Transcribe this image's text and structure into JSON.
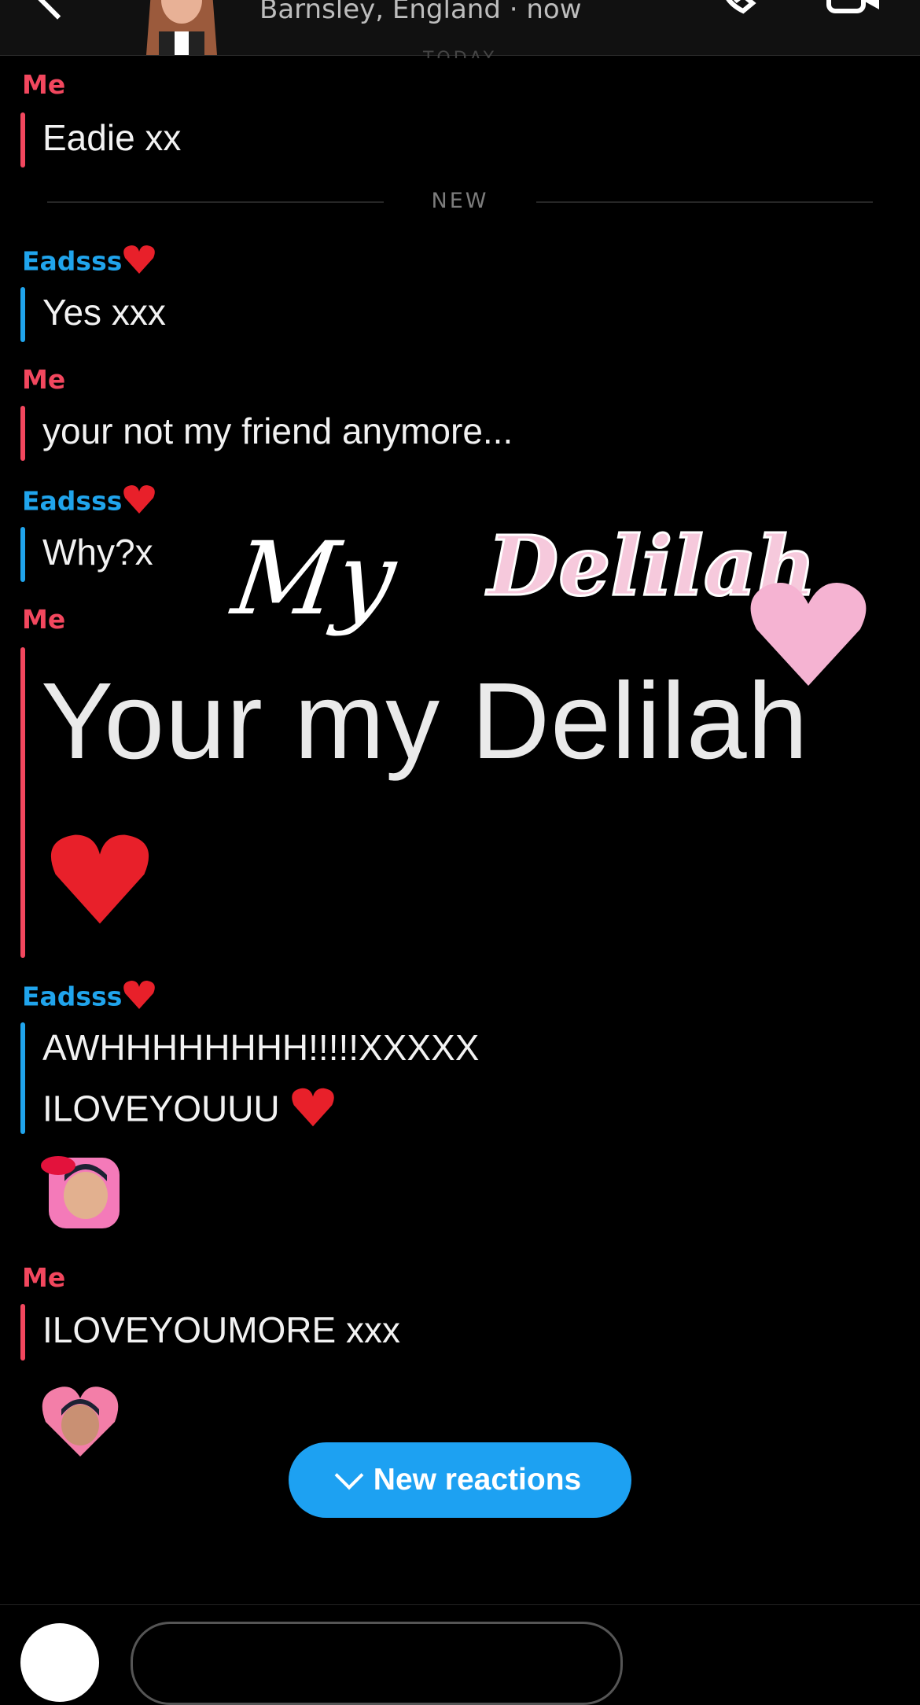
{
  "header": {
    "subtitle": "Barnsley, England · now",
    "today_label": "TODAY"
  },
  "divider_label": "NEW",
  "messages": [
    {
      "sender": "Me",
      "text": "Eadie xx"
    },
    {
      "sender": "Eadsss",
      "text": "Yes xxx"
    },
    {
      "sender": "Me",
      "text": "your not my friend anymore..."
    },
    {
      "sender": "Eadsss",
      "text": "Why?x"
    },
    {
      "sender": "Me",
      "text": "Your my Delilah"
    },
    {
      "sender": "Eadsss",
      "line1": "AWHHHHHHHH!!!!!XXXXX",
      "line2": "ILOVEYOUUU"
    },
    {
      "sender": "Me",
      "text": "ILOVEYOUMORE xxx"
    }
  ],
  "sticker": {
    "word1": "My",
    "word2": "Delilah"
  },
  "new_reactions_button": "New reactions",
  "colors": {
    "me": "#f2475e",
    "her": "#20a4ec",
    "button": "#1da1f2"
  },
  "icons": [
    "back-chevron-icon",
    "avatar",
    "phone-icon",
    "video-camera-icon",
    "heart-emoji-icon",
    "chevron-down-icon",
    "camera-icon"
  ]
}
